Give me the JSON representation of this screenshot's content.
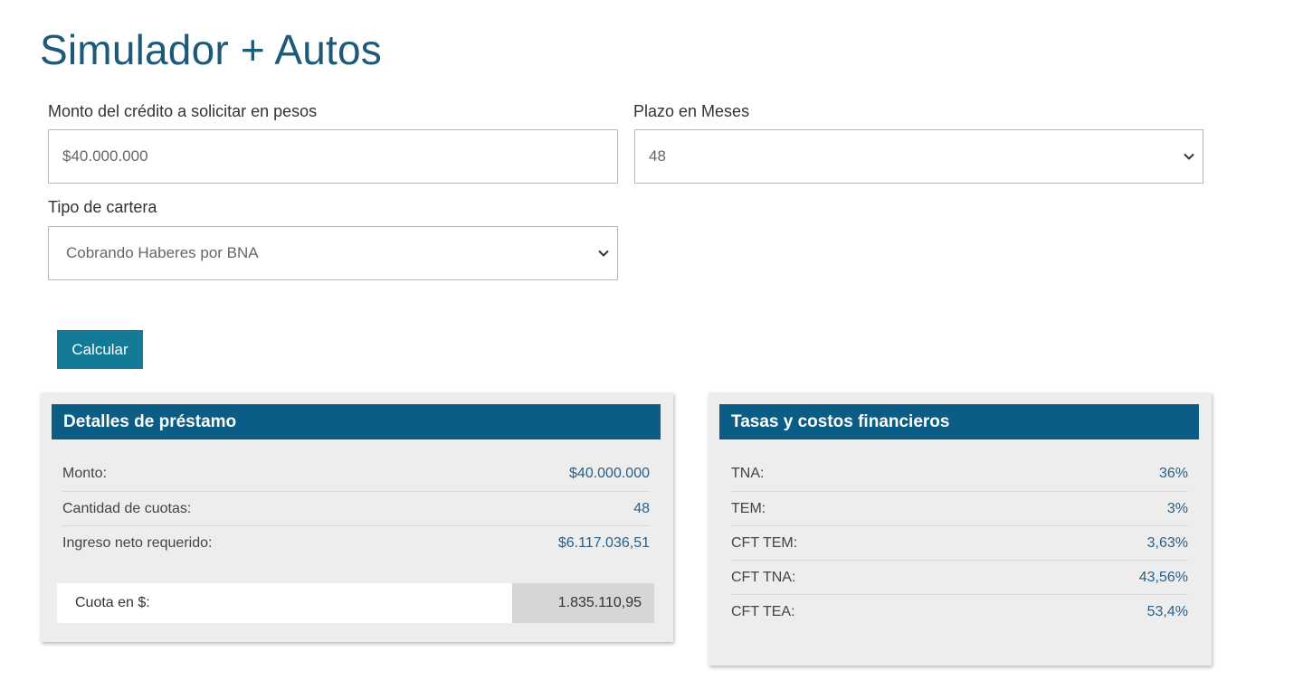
{
  "page": {
    "title": "Simulador + Autos"
  },
  "form": {
    "monto": {
      "label": "Monto del crédito a solicitar en pesos",
      "value": "$40.000.000"
    },
    "plazo": {
      "label": "Plazo en Meses",
      "selected": "48"
    },
    "cartera": {
      "label": "Tipo de cartera",
      "selected": "Cobrando Haberes por BNA"
    },
    "calcular_label": "Calcular"
  },
  "detalles": {
    "title": "Detalles de préstamo",
    "rows": [
      {
        "label": "Monto:",
        "value": "$40.000.000"
      },
      {
        "label": "Cantidad de cuotas:",
        "value": "48"
      },
      {
        "label": "Ingreso neto requerido:",
        "value": "$6.117.036,51"
      }
    ],
    "cuota_label": "Cuota en $:",
    "cuota_value": "1.835.110,95"
  },
  "tasas": {
    "title": "Tasas y costos financieros",
    "rows": [
      {
        "label": "TNA:",
        "value": "36%"
      },
      {
        "label": "TEM:",
        "value": "3%"
      },
      {
        "label": "CFT TEM:",
        "value": "3,63%"
      },
      {
        "label": "CFT TNA:",
        "value": "43,56%"
      },
      {
        "label": "CFT TEA:",
        "value": "53,4%"
      }
    ]
  },
  "icons": {
    "select_chevron": "chevron-down-icon"
  },
  "colors": {
    "title": "#1c5a77",
    "header_bg": "#0b5d86",
    "button_bg": "#137a97",
    "value_text": "#2a5f86",
    "panel_bg": "#ededed"
  }
}
